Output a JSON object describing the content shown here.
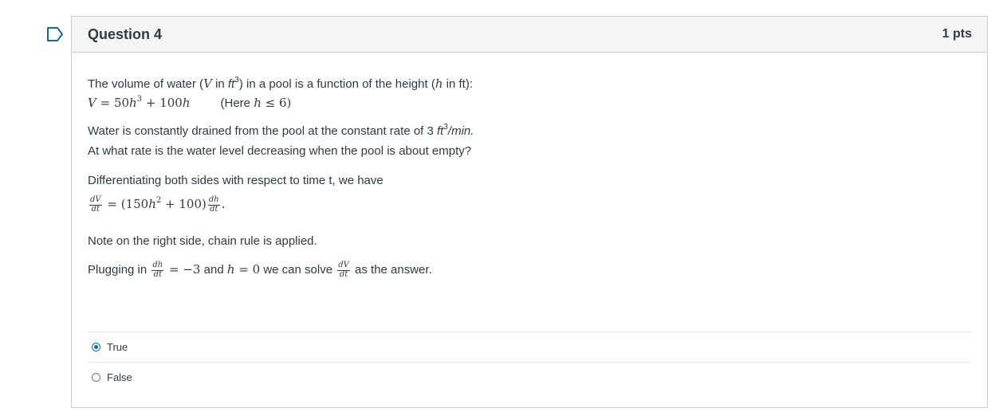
{
  "question": {
    "title": "Question 4",
    "points": "1 pts"
  },
  "content": {
    "line1": {
      "t1": "The volume of water (",
      "v": "V",
      "t2": " in ",
      "unit": "ft",
      "exp": "3",
      "t3": ") in a pool is a function of the height  (",
      "h": "h",
      "t4": " in ft):"
    },
    "line2": {
      "v": "V",
      "eq": " = 50",
      "h": "h",
      "exp": "3",
      "plus": " + 100",
      "h2": "h",
      "note_open": "(Here ",
      "h3": "h",
      "note_rest": " ≤ 6)"
    },
    "line3": {
      "t1": "Water is constantly drained from the pool at the constant rate of 3 ",
      "unit": "ft",
      "exp": "3",
      "t2": "/min."
    },
    "line4": "At what rate is the water level decreasing when the pool is about empty?",
    "line5": "Differentiating both sides with respect to time t, we have",
    "line6": {
      "frac1_num": "dV",
      "frac1_den": "dt",
      "eq": " = (150",
      "h": "h",
      "exp": "2",
      "rest": " + 100)",
      "frac2_num": "dh",
      "frac2_den": "dt",
      "dot": "."
    },
    "line7": "Note on the right side, chain rule is applied.",
    "line8": {
      "t1": "Plugging in ",
      "frac1_num": "dh",
      "frac1_den": "dt",
      "eq": " = −3",
      "and": " and ",
      "h": "h",
      "eq2": " = 0",
      "t2": " we can solve  ",
      "frac2_num": "dV",
      "frac2_den": "dt",
      "t3": "  as the answer."
    }
  },
  "answers": [
    {
      "label": "True",
      "selected": true
    },
    {
      "label": "False",
      "selected": false
    }
  ],
  "colors": {
    "accent": "#0770a3",
    "text": "#2d3b45",
    "border": "#c7cdd1"
  }
}
